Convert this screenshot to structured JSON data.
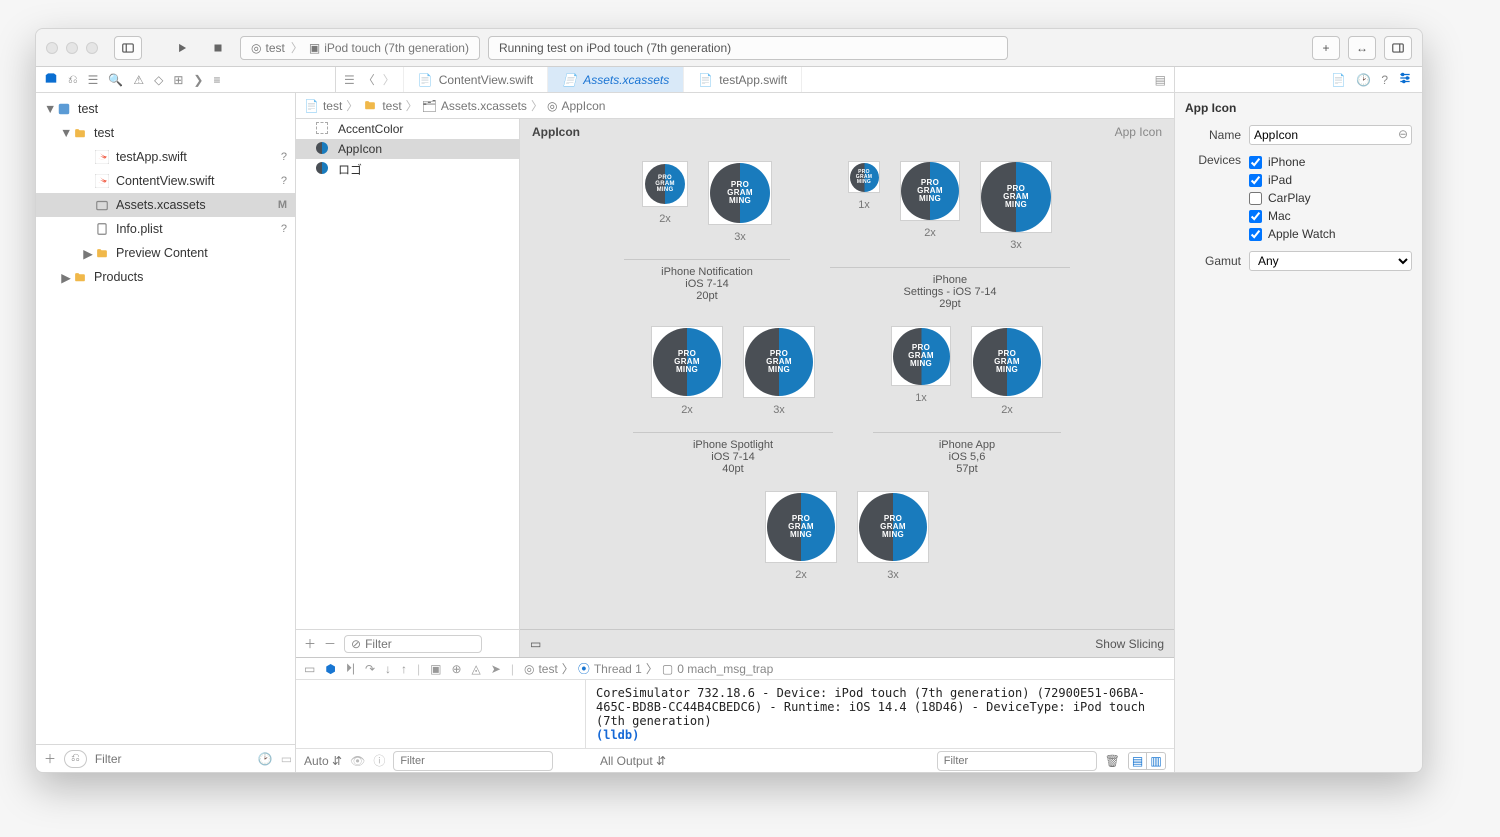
{
  "toolbar": {
    "scheme_target": "test",
    "scheme_device": "iPod touch (7th generation)",
    "status_text": "Running test on iPod touch (7th generation)"
  },
  "tabs": [
    {
      "label": "ContentView.swift",
      "active": false
    },
    {
      "label": "Assets.xcassets",
      "active": true
    },
    {
      "label": "testApp.swift",
      "active": false
    }
  ],
  "navigator": {
    "root": "test",
    "items": [
      {
        "label": "test",
        "indent": 0,
        "kind": "project",
        "badge": "",
        "disclosure": "▼"
      },
      {
        "label": "test",
        "indent": 1,
        "kind": "folder",
        "badge": "",
        "disclosure": "▼"
      },
      {
        "label": "testApp.swift",
        "indent": 2,
        "kind": "swift",
        "badge": "?"
      },
      {
        "label": "ContentView.swift",
        "indent": 2,
        "kind": "swift",
        "badge": "?"
      },
      {
        "label": "Assets.xcassets",
        "indent": 2,
        "kind": "assets",
        "badge": "M",
        "selected": true
      },
      {
        "label": "Info.plist",
        "indent": 2,
        "kind": "plist",
        "badge": "?"
      },
      {
        "label": "Preview Content",
        "indent": 2,
        "kind": "folder",
        "disclosure": "▶"
      },
      {
        "label": "Products",
        "indent": 1,
        "kind": "folder",
        "disclosure": "▶"
      }
    ],
    "filter_placeholder": "Filter"
  },
  "breadcrumb": [
    "test",
    "test",
    "Assets.xcassets",
    "AppIcon"
  ],
  "assetlist": {
    "items": [
      {
        "label": "AccentColor",
        "kind": "color"
      },
      {
        "label": "AppIcon",
        "kind": "appicon",
        "selected": true
      },
      {
        "label": "ロゴ",
        "kind": "image"
      }
    ],
    "filter_placeholder": "Filter"
  },
  "canvas": {
    "title": "AppIcon",
    "type_label": "App Icon",
    "groups": [
      {
        "sets": [
          {
            "name1": "iPhone Notification",
            "name2": "iOS 7-14",
            "size": "20pt",
            "cells": [
              {
                "scale": "2x",
                "slot": 46,
                "logo": 40
              },
              {
                "scale": "3x",
                "slot": 64,
                "logo": 60
              }
            ]
          },
          {
            "name1": "iPhone",
            "name2": "Settings - iOS 7-14",
            "size": "29pt",
            "cells": [
              {
                "scale": "1x",
                "slot": 32,
                "logo": 29
              },
              {
                "scale": "2x",
                "slot": 60,
                "logo": 58
              },
              {
                "scale": "3x",
                "slot": 72,
                "logo": 70
              }
            ]
          }
        ]
      },
      {
        "sets": [
          {
            "name1": "iPhone Spotlight",
            "name2": "iOS 7-14",
            "size": "40pt",
            "cells": [
              {
                "scale": "2x",
                "slot": 72,
                "logo": 68
              },
              {
                "scale": "3x",
                "slot": 72,
                "logo": 68
              }
            ]
          },
          {
            "name1": "iPhone App",
            "name2": "iOS 5,6",
            "size": "57pt",
            "cells": [
              {
                "scale": "1x",
                "slot": 60,
                "logo": 57
              },
              {
                "scale": "2x",
                "slot": 72,
                "logo": 68
              }
            ]
          }
        ]
      },
      {
        "sets": [
          {
            "name1": "",
            "name2": "",
            "size": "",
            "cells": [
              {
                "scale": "2x",
                "slot": 72,
                "logo": 68
              },
              {
                "scale": "3x",
                "slot": 72,
                "logo": 68
              }
            ]
          }
        ]
      }
    ],
    "show_slicing": "Show Slicing"
  },
  "debug": {
    "breadcrumb_thread": "test",
    "thread_label": "Thread 1",
    "frame_label": "0 mach_msg_trap",
    "console_line1": "CoreSimulator 732.18.6 - Device: iPod touch (7th generation) (72900E51-06BA-465C-BD8B-CC44B4CBEDC6) - Runtime: iOS 14.4 (18D46) - DeviceType: iPod touch (7th generation)",
    "lldb": "(lldb)",
    "auto_label": "Auto",
    "filter_placeholder": "Filter",
    "output_label": "All Output"
  },
  "inspector": {
    "section_title": "App Icon",
    "name_label": "Name",
    "name_value": "AppIcon",
    "devices_label": "Devices",
    "devices": [
      {
        "label": "iPhone",
        "checked": true
      },
      {
        "label": "iPad",
        "checked": true
      },
      {
        "label": "CarPlay",
        "checked": false
      },
      {
        "label": "Mac",
        "checked": true
      },
      {
        "label": "Apple Watch",
        "checked": true
      }
    ],
    "gamut_label": "Gamut",
    "gamut_value": "Any"
  }
}
